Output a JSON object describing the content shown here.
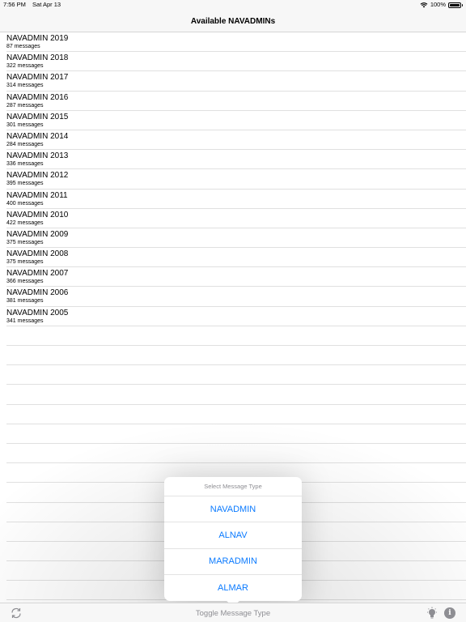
{
  "status": {
    "time": "7:56 PM",
    "date": "Sat Apr 13",
    "battery": "100%",
    "battery_level": 1.0
  },
  "nav": {
    "title": "Available NAVADMINs"
  },
  "list": [
    {
      "title": "NAVADMIN 2019",
      "subtitle": "87 messages"
    },
    {
      "title": "NAVADMIN 2018",
      "subtitle": "322 messages"
    },
    {
      "title": "NAVADMIN 2017",
      "subtitle": "314 messages"
    },
    {
      "title": "NAVADMIN 2016",
      "subtitle": "287 messages"
    },
    {
      "title": "NAVADMIN 2015",
      "subtitle": "301 messages"
    },
    {
      "title": "NAVADMIN 2014",
      "subtitle": "284 messages"
    },
    {
      "title": "NAVADMIN 2013",
      "subtitle": "336 messages"
    },
    {
      "title": "NAVADMIN 2012",
      "subtitle": "395 messages"
    },
    {
      "title": "NAVADMIN 2011",
      "subtitle": "400 messages"
    },
    {
      "title": "NAVADMIN 2010",
      "subtitle": "422 messages"
    },
    {
      "title": "NAVADMIN 2009",
      "subtitle": "375 messages"
    },
    {
      "title": "NAVADMIN 2008",
      "subtitle": "375 messages"
    },
    {
      "title": "NAVADMIN 2007",
      "subtitle": "366 messages"
    },
    {
      "title": "NAVADMIN 2006",
      "subtitle": "381 messages"
    },
    {
      "title": "NAVADMIN 2005",
      "subtitle": "341 messages"
    }
  ],
  "popover": {
    "header": "Select Message Type",
    "options": [
      "NAVADMIN",
      "ALNAV",
      "MARADMIN",
      "ALMAR"
    ]
  },
  "toolbar": {
    "center_label": "Toggle Message Type",
    "refresh_icon": "refresh-icon",
    "lightbulb_icon": "lightbulb-icon",
    "info_icon": "info-icon",
    "info_glyph": "i"
  },
  "colors": {
    "accent": "#0a7aff",
    "secondary_text": "#8e8e93",
    "bar_bg": "#f7f7f7"
  }
}
